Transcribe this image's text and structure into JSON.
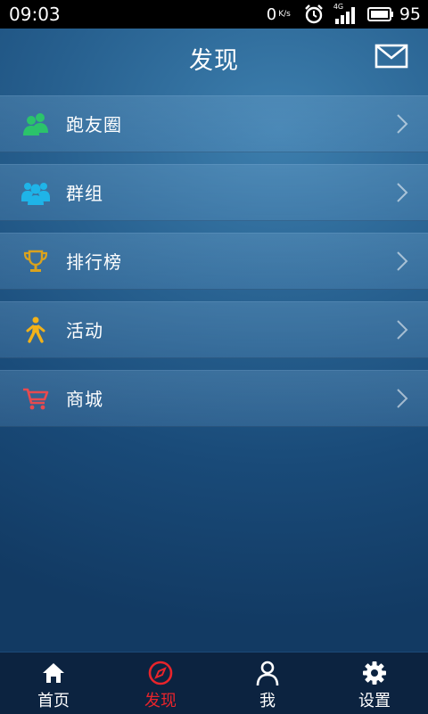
{
  "status_bar": {
    "time": "09:03",
    "net_speed": "0",
    "net_unit": "K/s",
    "network_type": "4G",
    "battery": "95"
  },
  "header": {
    "title": "发现",
    "mail_icon": "mail-icon"
  },
  "menu": {
    "items": [
      {
        "label": "跑友圈",
        "icon": "runner-friends-icon",
        "icon_color": "#2bc36b"
      },
      {
        "label": "群组",
        "icon": "group-icon",
        "icon_color": "#1fb4e8"
      },
      {
        "label": "排行榜",
        "icon": "trophy-icon",
        "icon_color": "#d9a21e"
      },
      {
        "label": "活动",
        "icon": "walking-person-icon",
        "icon_color": "#f2b21a"
      },
      {
        "label": "商城",
        "icon": "shopping-cart-icon",
        "icon_color": "#e84a4f"
      }
    ]
  },
  "tabs": [
    {
      "label": "首页",
      "icon": "home-icon",
      "active": false
    },
    {
      "label": "发现",
      "icon": "compass-icon",
      "active": true
    },
    {
      "label": "我",
      "icon": "person-icon",
      "active": false
    },
    {
      "label": "设置",
      "icon": "gear-icon",
      "active": false
    }
  ],
  "colors": {
    "active_tab": "#e8242b",
    "tab_bar_bg": "#0c2340",
    "background_top": "#3d7fae",
    "background_bottom": "#123a63"
  }
}
